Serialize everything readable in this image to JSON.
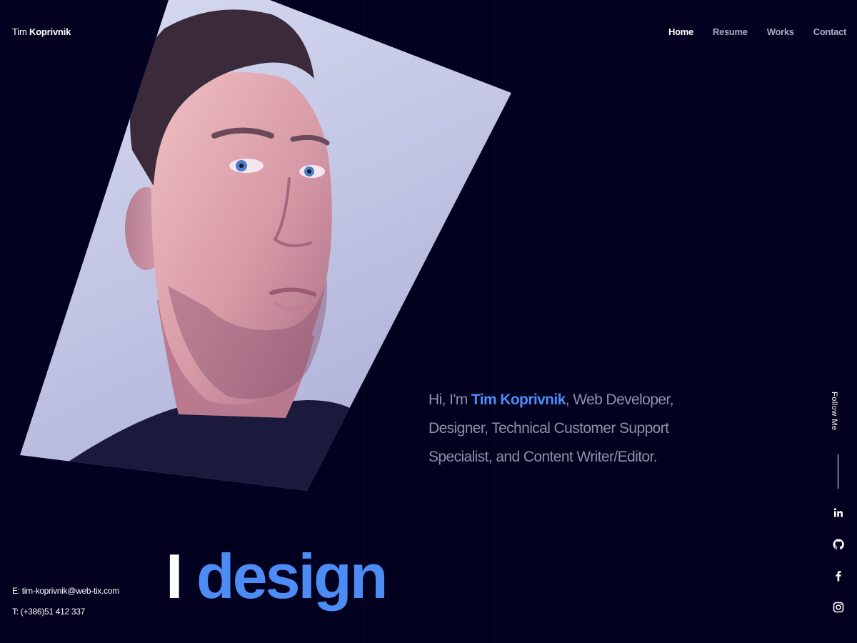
{
  "logo": {
    "first": "Tim ",
    "last": "Koprivnik"
  },
  "nav": {
    "items": [
      {
        "label": "Home",
        "active": true
      },
      {
        "label": "Resume",
        "active": false
      },
      {
        "label": "Works",
        "active": false
      },
      {
        "label": "Contact",
        "active": false
      }
    ]
  },
  "hero": {
    "photo_icon": "portrait-photo",
    "intro_prefix": "Hi, I'm ",
    "intro_name": "Tim Koprivnik",
    "intro_suffix": ", Web Developer, Designer, Technical Customer Support Specialist, and Content Writer/Editor.",
    "big_prefix": "I ",
    "big_word": "design"
  },
  "contact": {
    "email": "E: tim-koprivnik@web-tix.com",
    "phone": "T: (+386)51 412 337"
  },
  "social": {
    "label": "Follow Me",
    "icons": [
      "linkedin-icon",
      "github-icon",
      "facebook-icon",
      "instagram-icon"
    ]
  },
  "colors": {
    "background": "#02011f",
    "accent": "#4d8bf5",
    "text": "#ffffff",
    "muted": "#8e90a8"
  }
}
